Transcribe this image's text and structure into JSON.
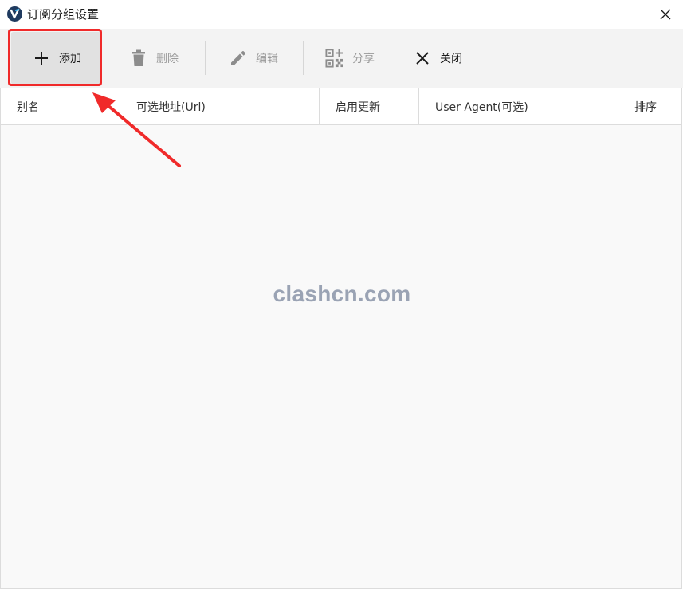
{
  "window": {
    "title": "订阅分组设置",
    "app_icon": "v2rayn-logo-icon",
    "close_icon": "close-icon"
  },
  "toolbar": {
    "add_label": "添加",
    "delete_label": "删除",
    "edit_label": "编辑",
    "share_label": "分享",
    "close_label": "关闭"
  },
  "table": {
    "columns": [
      "别名",
      "可选地址(Url)",
      "启用更新",
      "User Agent(可选)",
      "排序"
    ],
    "rows": []
  },
  "watermark": "clashcn.com",
  "colors": {
    "highlight": "#f02a2a",
    "toolbar_bg": "#f3f3f3",
    "active_button_bg": "#e1e1e1",
    "disabled_text": "#9a9a9a",
    "watermark": "#9aa3b4"
  }
}
